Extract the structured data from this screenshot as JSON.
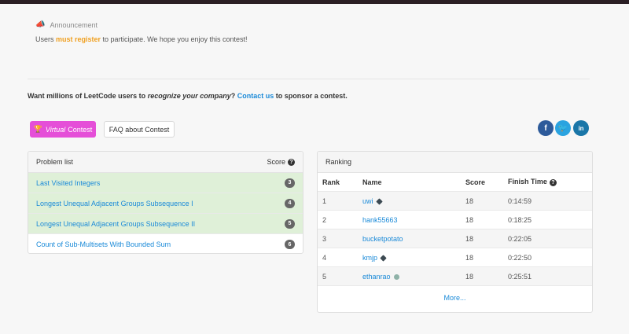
{
  "announcement": {
    "icon": "megaphone-icon",
    "heading": "Announcement",
    "text_before": "Users ",
    "highlight": "must register",
    "text_after": " to participate. We hope you enjoy this contest!"
  },
  "sponsor": {
    "part1": "Want millions of LeetCode users to ",
    "emphasis": "recognize your company",
    "part2": "? ",
    "link": "Contact us",
    "part3": " to sponsor a contest."
  },
  "buttons": {
    "virtual_em": "Virtual",
    "virtual_rest": "Contest",
    "faq": "FAQ about Contest"
  },
  "social": {
    "facebook": "f",
    "twitter": "t",
    "linkedin": "in"
  },
  "problem_list": {
    "title": "Problem list",
    "score_label": "Score",
    "rows": [
      {
        "name": "Last Visited Integers",
        "score": "3"
      },
      {
        "name": "Longest Unequal Adjacent Groups Subsequence I",
        "score": "4"
      },
      {
        "name": "Longest Unequal Adjacent Groups Subsequence II",
        "score": "5"
      },
      {
        "name": "Count of Sub-Multisets With Bounded Sum",
        "score": "6"
      }
    ]
  },
  "ranking": {
    "title": "Ranking",
    "headers": {
      "rank": "Rank",
      "name": "Name",
      "score": "Score",
      "finish": "Finish Time"
    },
    "rows": [
      {
        "rank": "1",
        "name": "uwi",
        "score": "18",
        "time": "0:14:59"
      },
      {
        "rank": "2",
        "name": "hank55663",
        "score": "18",
        "time": "0:18:25"
      },
      {
        "rank": "3",
        "name": "bucketpotato",
        "score": "18",
        "time": "0:22:05"
      },
      {
        "rank": "4",
        "name": "kmjp",
        "score": "18",
        "time": "0:22:50"
      },
      {
        "rank": "5",
        "name": "ethanrao",
        "score": "18",
        "time": "0:25:51"
      }
    ],
    "more": "More..."
  },
  "colors": {
    "accent_link": "#1a8ad8",
    "highlight_orange": "#f0a020",
    "virtual_button": "#e54fd8",
    "solved_row": "#dff0d8"
  }
}
